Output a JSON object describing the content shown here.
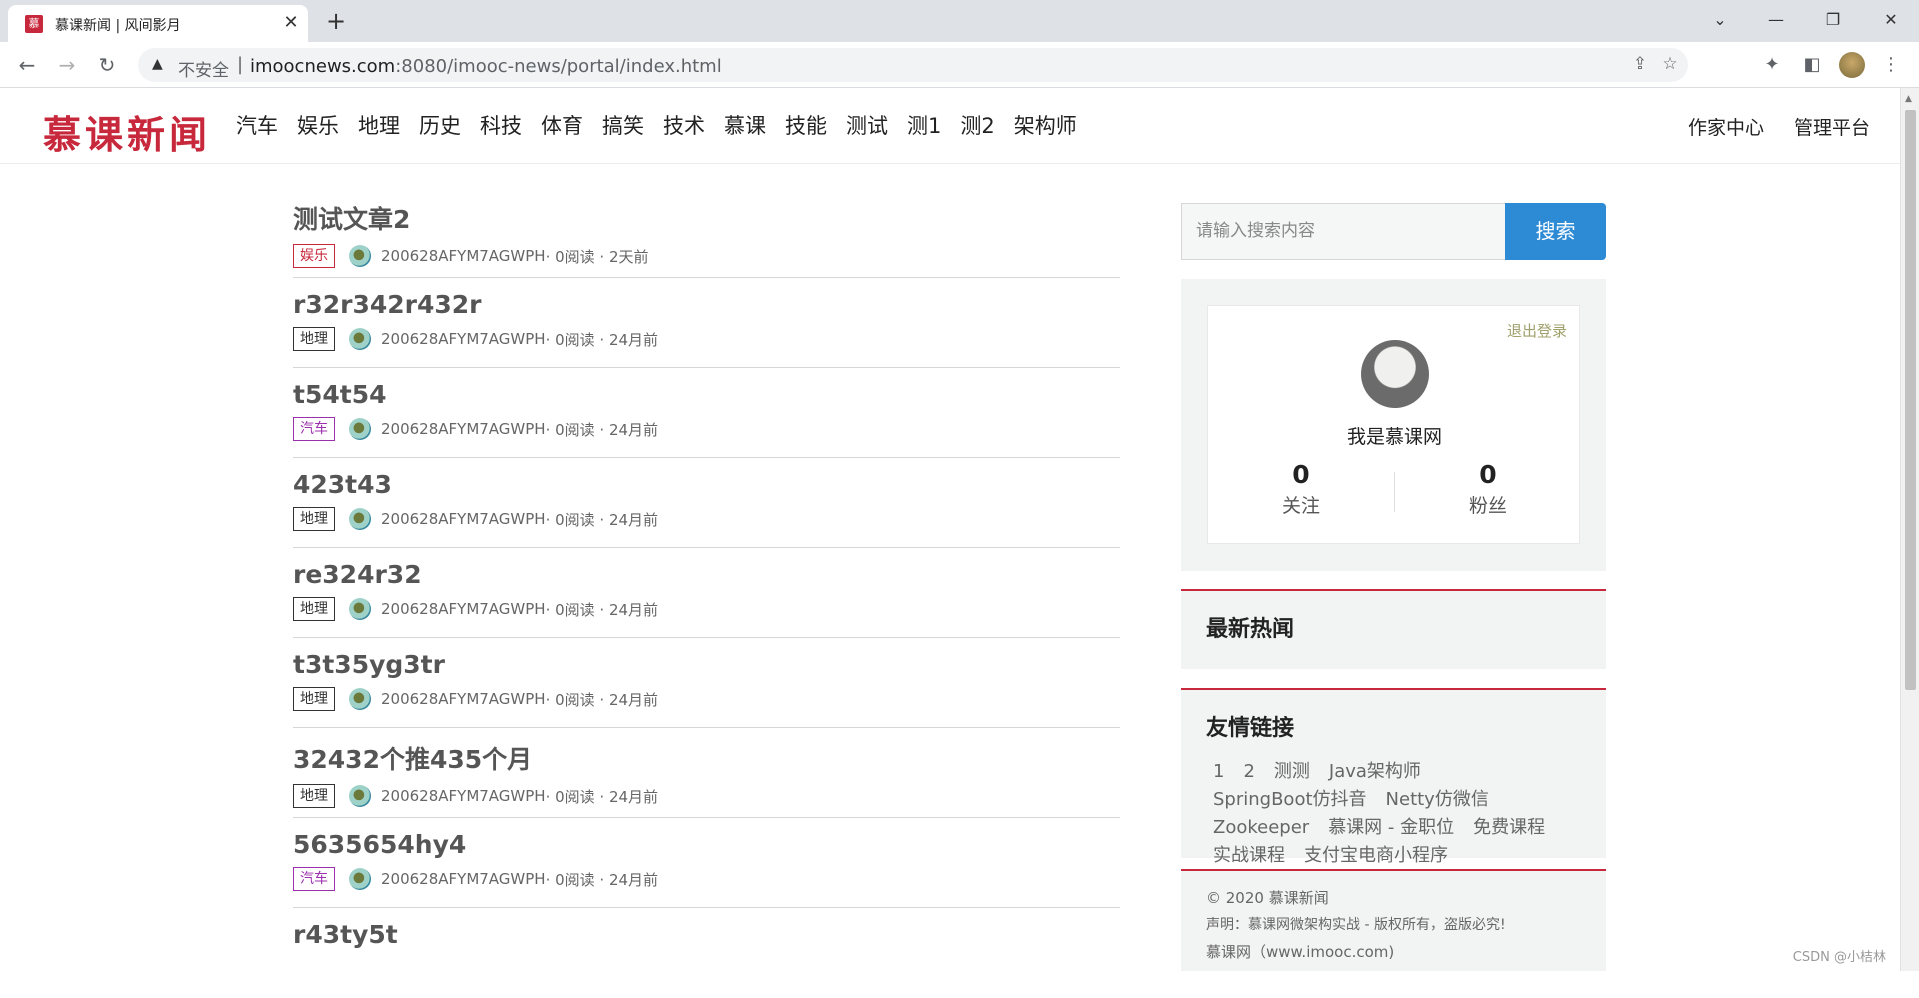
{
  "browser": {
    "tab_title": "慕课新闻 | 风间影月",
    "tab_favicon": "慕",
    "close_glyph": "✕",
    "new_tab_glyph": "+",
    "not_secure": "不安全",
    "url_host": "imoocnews.com",
    "url_rest": ":8080/imooc-news/portal/index.html",
    "separator": "|"
  },
  "site": {
    "logo": "慕课新闻",
    "nav": [
      "汽车",
      "娱乐",
      "地理",
      "历史",
      "科技",
      "体育",
      "搞笑",
      "技术",
      "慕课",
      "技能",
      "测试",
      "测1",
      "测2",
      "架构师"
    ],
    "header_right": [
      "作家中心",
      "管理平台"
    ]
  },
  "articles": [
    {
      "title": "测试文章2",
      "tag": "娱乐",
      "tag_color": "#c8283c",
      "author": "200628AFYM7AGWPH",
      "meta": " · 0阅读 · 2天前"
    },
    {
      "title": "r32r342r432r",
      "tag": "地理",
      "tag_color": "#333333",
      "author": "200628AFYM7AGWPH",
      "meta": " · 0阅读 · 24月前"
    },
    {
      "title": "t54t54",
      "tag": "汽车",
      "tag_color": "#9b2fae",
      "author": "200628AFYM7AGWPH",
      "meta": " · 0阅读 · 24月前"
    },
    {
      "title": "423t43",
      "tag": "地理",
      "tag_color": "#333333",
      "author": "200628AFYM7AGWPH",
      "meta": " · 0阅读 · 24月前"
    },
    {
      "title": "re324r32",
      "tag": "地理",
      "tag_color": "#333333",
      "author": "200628AFYM7AGWPH",
      "meta": " · 0阅读 · 24月前"
    },
    {
      "title": "t3t35yg3tr",
      "tag": "地理",
      "tag_color": "#333333",
      "author": "200628AFYM7AGWPH",
      "meta": " · 0阅读 · 24月前"
    },
    {
      "title": "32432个推435个月",
      "tag": "地理",
      "tag_color": "#333333",
      "author": "200628AFYM7AGWPH",
      "meta": " · 0阅读 · 24月前"
    },
    {
      "title": "5635654hy4",
      "tag": "汽车",
      "tag_color": "#9b2fae",
      "author": "200628AFYM7AGWPH",
      "meta": " · 0阅读 · 24月前"
    },
    {
      "title": "r43ty5t",
      "tag": "",
      "tag_color": "#333333",
      "author": "",
      "meta": ""
    }
  ],
  "search": {
    "placeholder": "请输入搜索内容",
    "button": "搜索"
  },
  "user": {
    "logout": "退出登录",
    "name": "我是慕课网",
    "follow_count": "0",
    "follow_label": "关注",
    "fans_count": "0",
    "fans_label": "粉丝"
  },
  "hot": {
    "title": "最新热闻"
  },
  "friends": {
    "title": "友情链接",
    "links": [
      "1",
      "2",
      "测测",
      "Java架构师",
      "SpringBoot仿抖音",
      "Netty仿微信",
      "Zookeeper",
      "慕课网 - 金职位",
      "免费课程",
      "实战课程",
      "支付宝电商小程序"
    ]
  },
  "footer": {
    "copyright": "© 2020 慕课新闻",
    "statement": "声明：慕课网微架构实战 - 版权所有，盗版必究!",
    "site": "慕课网（www.imooc.com)"
  },
  "watermark": "CSDN @小桔林",
  "colors": {
    "brand": "#c8283c",
    "search_button": "#2d8bd6"
  }
}
